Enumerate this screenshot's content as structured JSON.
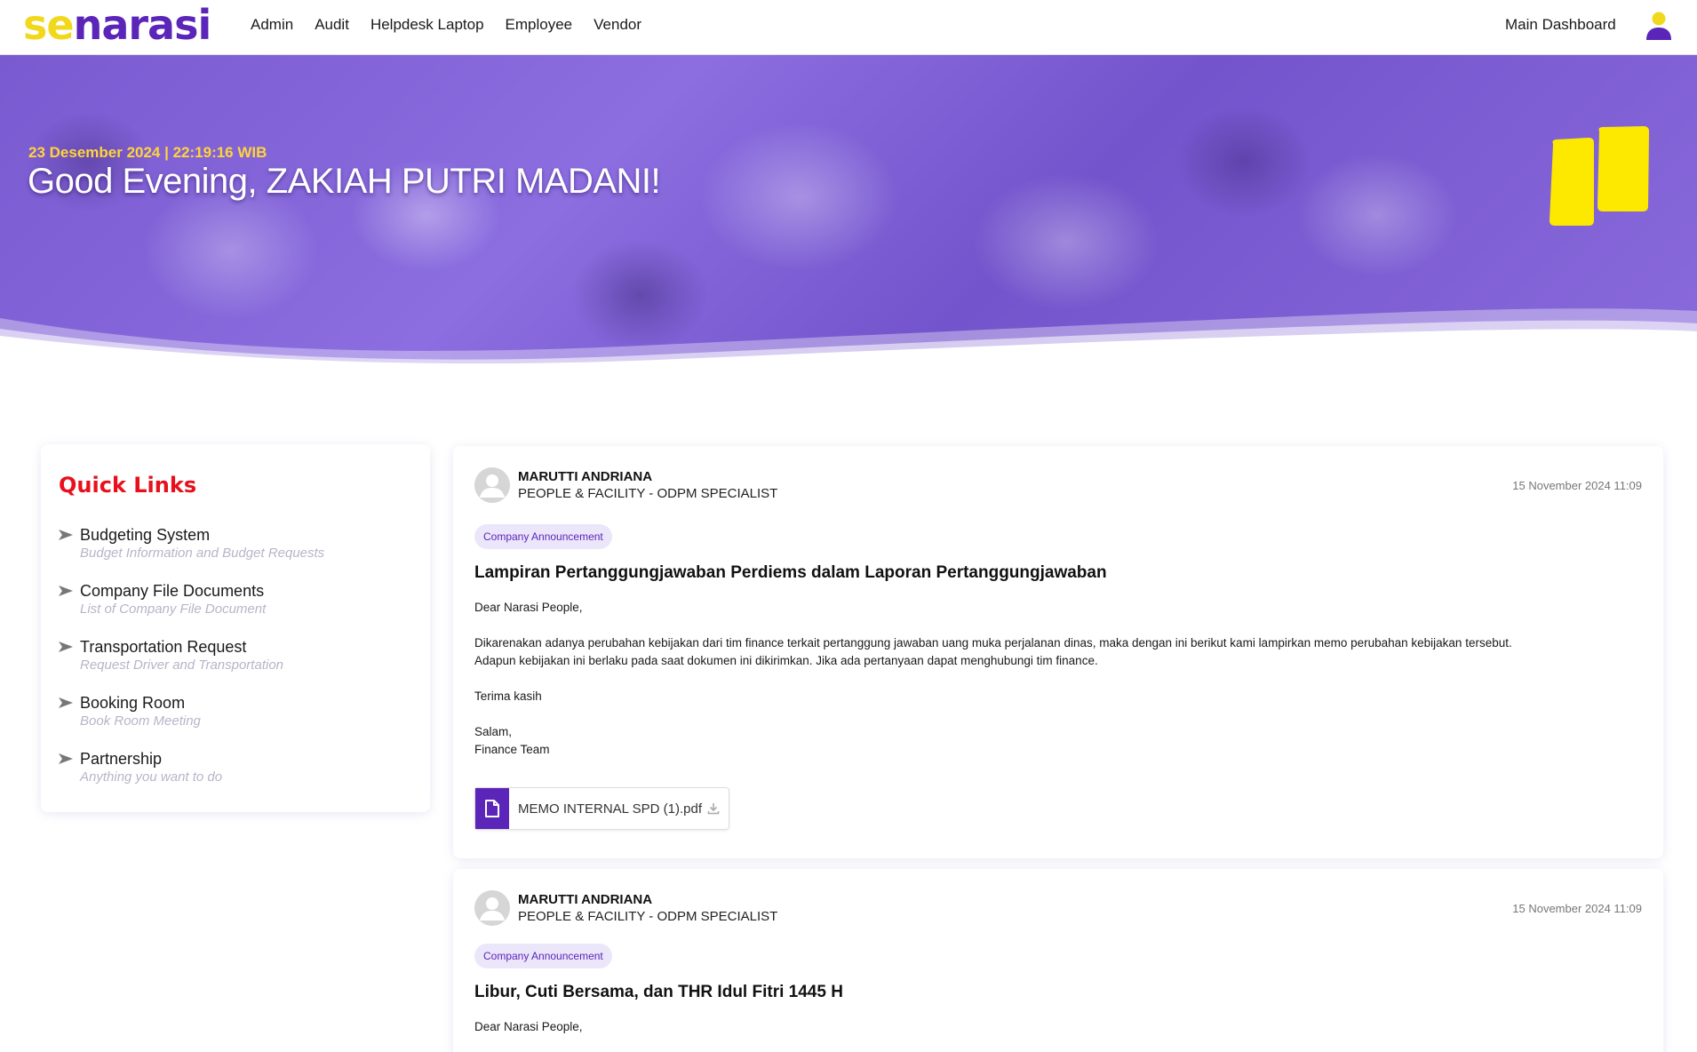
{
  "header": {
    "logo_se": "se",
    "logo_narasi": "narasi",
    "nav": [
      "Admin",
      "Audit",
      "Helpdesk Laptop",
      "Employee",
      "Vendor"
    ],
    "main_dashboard": "Main Dashboard",
    "user_icon": "user-icon"
  },
  "hero": {
    "datetime": "23 Desember 2024 | 22:19:16 WIB",
    "greeting": "Good Evening, ZAKIAH PUTRI MADANI!"
  },
  "quick_links": {
    "title": "Quick Links",
    "items": [
      {
        "name": "Budgeting System",
        "desc": "Budget Information and Budget Requests"
      },
      {
        "name": "Company File Documents",
        "desc": "List of Company File Document"
      },
      {
        "name": "Transportation Request",
        "desc": "Request Driver and Transportation"
      },
      {
        "name": "Booking Room",
        "desc": "Book Room Meeting"
      },
      {
        "name": "Partnership",
        "desc": "Anything you want to do"
      }
    ]
  },
  "posts": [
    {
      "author": "MARUTTI ANDRIANA",
      "dept": "PEOPLE & FACILITY - ODPM SPECIALIST",
      "time": "15 November 2024 11:09",
      "badge": "Company Announcement",
      "title": "Lampiran Pertanggungjawaban Perdiems dalam Laporan Pertanggungjawaban",
      "greeting": "Dear Narasi People,",
      "body_line1": "Dikarenakan adanya perubahan kebijakan dari tim finance terkait pertanggung jawaban uang muka perjalanan dinas, maka dengan ini berikut kami lampirkan memo perubahan kebijakan tersebut.",
      "body_line2": "Adapun kebijakan ini berlaku pada saat dokumen ini dikirimkan. Jika ada pertanyaan dapat menghubungi tim finance.",
      "thanks": "Terima kasih",
      "salam": "Salam,",
      "signature": "Finance Team",
      "attachment": "MEMO INTERNAL SPD (1).pdf"
    },
    {
      "author": "MARUTTI ANDRIANA",
      "dept": "PEOPLE & FACILITY - ODPM SPECIALIST",
      "time": "15 November 2024 11:09",
      "badge": "Company Announcement",
      "title": "Libur, Cuti Bersama, dan THR Idul Fitri 1445 H",
      "greeting": "Dear Narasi People,"
    }
  ],
  "colors": {
    "brand_purple": "#5a25b8",
    "brand_yellow": "#f2d81c",
    "quick_links_red": "#e8101c"
  }
}
